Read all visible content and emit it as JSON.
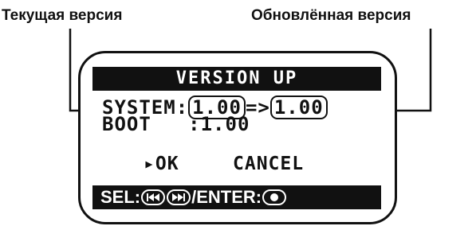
{
  "callouts": {
    "current_version": "Текущая версия",
    "updated_version": "Обновлённая версия"
  },
  "screen": {
    "title": "VERSION UP",
    "system_label": "SYSTEM:",
    "system_current": "1.00",
    "arrow": "=>",
    "system_new": "1.00",
    "boot_label": "BOOT   :",
    "boot_value": "1.00",
    "cursor": "▸",
    "ok_label": "OK",
    "cancel_label": "CANCEL",
    "sel_label": "SEL:",
    "separator": "/",
    "enter_label": "ENTER:"
  },
  "icons": {
    "sel_left": "skip-back-icon",
    "sel_right": "skip-forward-icon",
    "enter": "record-button-icon"
  },
  "colors": {
    "ink": "#111111",
    "background": "#ffffff",
    "bar_text": "#ffffff"
  }
}
